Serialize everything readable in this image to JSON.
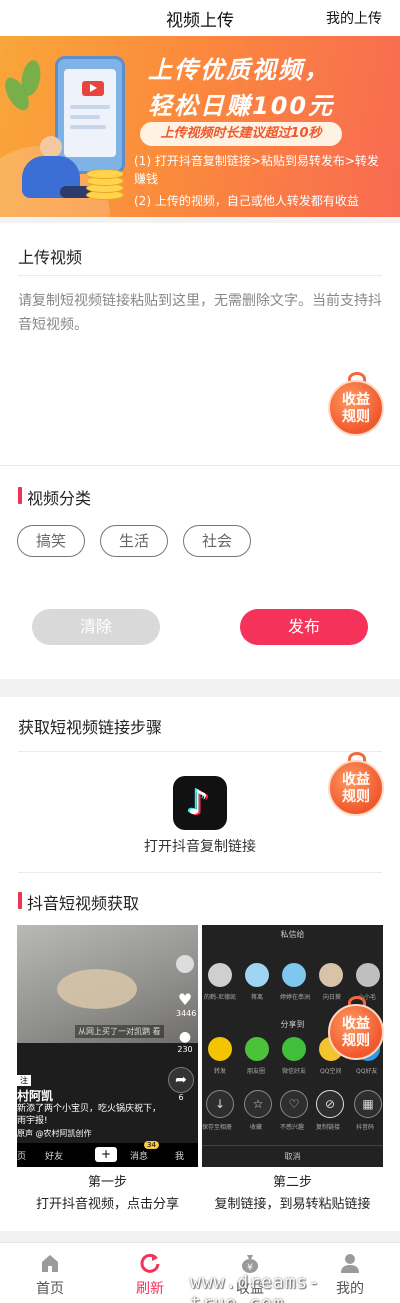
{
  "header": {
    "title": "视频上传",
    "my_uploads": "我的上传"
  },
  "banner": {
    "headline1": "上传优质视频，",
    "headline2": "轻松日赚100元",
    "pill": "上传视频时长建议超过10秒",
    "tip1": "(1) 打开抖音复制链接>粘贴到易转发布>转发赚钱",
    "tip2": "(2) 上传的视频，自己或他人转发都有收益"
  },
  "upload": {
    "title": "上传视频",
    "placeholder": "请复制短视频链接粘贴到这里，无需删除文字。当前支持抖音短视频。"
  },
  "badge": {
    "line1": "收益",
    "line2": "规则"
  },
  "category": {
    "title": "视频分类",
    "tags": [
      "搞笑",
      "生活",
      "社会"
    ]
  },
  "actions": {
    "clear": "清除",
    "publish": "发布"
  },
  "steps": {
    "title": "获取短视频链接步骤",
    "open_link_label": "打开抖音复制链接"
  },
  "douyin": {
    "title": "抖音短视频获取",
    "step1": {
      "title": "第一步",
      "desc": "打开抖音视频，点击分享"
    },
    "step2": {
      "title": "第二步",
      "desc": "复制链接，到易转粘贴链接"
    },
    "shot1": {
      "caption": "从网上买了一对凯鹦 看",
      "likes": "3446",
      "comments": "230",
      "shares": "6",
      "tag": "注",
      "username": "村阿凯",
      "desc": "新添了两个小宝贝，吃火锅庆祝下，雨宇报!",
      "music": "原声  @农村阿凯创作",
      "nav_home": "页",
      "nav_friends": "好友",
      "nav_plus": "+",
      "nav_msg": "消息",
      "nav_msg_count": "34",
      "nav_me": "我"
    },
    "shot2": {
      "header": "私信给",
      "contacts": [
        "的鹤-尼德凯",
        "蒋离",
        "婷婷在串洲",
        "向日葵",
        "小小毛"
      ],
      "share_to": "分享到",
      "share_items": [
        "转发",
        "朋友圈",
        "微信好友",
        "QQ空间",
        "QQ好友"
      ],
      "actions": [
        "保存至相册",
        "收藏",
        "不感兴趣",
        "复制链接",
        "抖音码"
      ],
      "cancel": "取消"
    }
  },
  "tabbar": {
    "items": [
      {
        "label": "首页",
        "icon": "home-icon"
      },
      {
        "label": "刷新",
        "icon": "refresh-icon"
      },
      {
        "label": "收益",
        "icon": "money-bag-icon"
      },
      {
        "label": "我的",
        "icon": "user-icon"
      }
    ],
    "active_color": "#f53259"
  },
  "watermark": "www.dreams-true.com",
  "colors": {
    "accent": "#f53259",
    "banner_orange": "#fb8a3c",
    "badge": "#f0582e"
  }
}
